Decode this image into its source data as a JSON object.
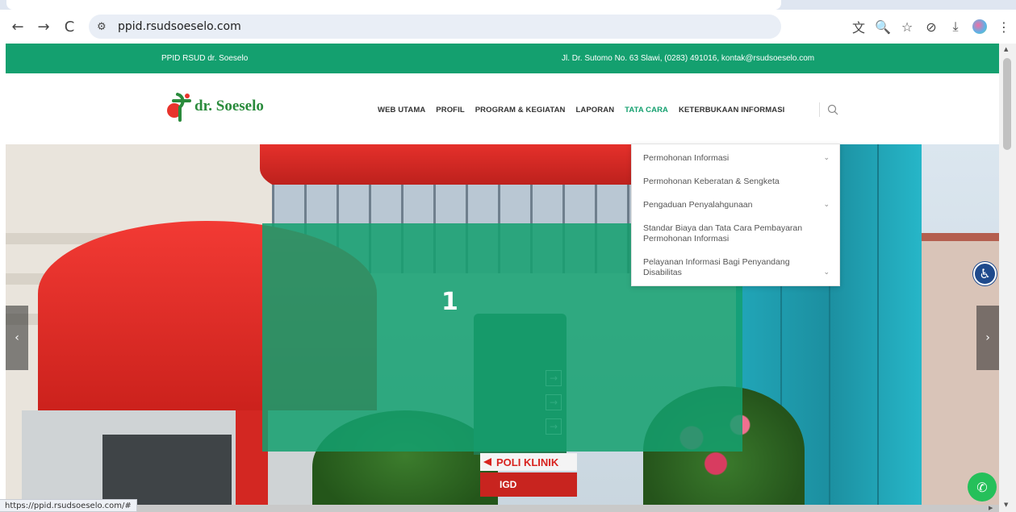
{
  "browser": {
    "url": "ppid.rsudsoeselo.com",
    "status_url": "https://ppid.rsudsoeselo.com/#",
    "icons": {
      "back": "←",
      "forward": "→",
      "reload": "C",
      "site_settings": "⚙",
      "translate": "文",
      "zoom": "🔍",
      "bookmark": "☆",
      "extensions": "⊘",
      "download": "⤓",
      "menu": "⋮"
    }
  },
  "topbar": {
    "left_text": "PPID RSUD dr. Soeselo",
    "right_text": "Jl. Dr. Sutomo No. 63 Slawi, (0283) 491016, kontak@rsudsoeselo.com",
    "color": "#14a06f"
  },
  "header": {
    "logo_text": "dr. Soeselo",
    "menu": [
      {
        "label": "WEB UTAMA"
      },
      {
        "label": "PROFIL"
      },
      {
        "label": "PROGRAM & KEGIATAN"
      },
      {
        "label": "LAPORAN"
      },
      {
        "label": "TATA CARA"
      },
      {
        "label": "KETERBUKAAN INFORMASI"
      }
    ],
    "active_menu": "TATA CARA"
  },
  "dropdown": {
    "items": [
      {
        "label": "Permohonan Informasi",
        "chevron": "⌄"
      },
      {
        "label": "Permohonan Keberatan & Sengketa",
        "chevron": ""
      },
      {
        "label": "Pengaduan Penyalahgunaan",
        "chevron": "⌄"
      },
      {
        "label": "Standar Biaya dan Tata Cara Pembayaran Permohonan Informasi",
        "chevron": ""
      },
      {
        "label": "Pelayanan Informasi Bagi Penyandang Disabilitas",
        "chevron": "⌄"
      }
    ]
  },
  "hero": {
    "slide_number": "1",
    "prev_label": "‹",
    "next_label": "›",
    "sign_poli": "POLI KLINIK",
    "sign_igd": "IGD",
    "overlay_color": "#14a06f"
  },
  "floating": {
    "accessibility_icon": "♿",
    "whatsapp_icon": "✆"
  }
}
